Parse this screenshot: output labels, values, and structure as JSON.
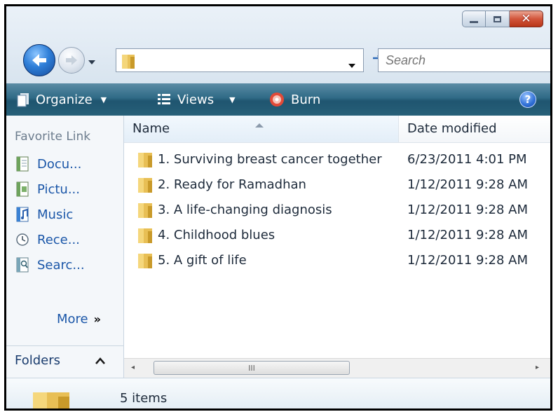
{
  "titlebar": {
    "buttons": [
      "minimize-icon",
      "maximize-icon",
      "close-icon"
    ]
  },
  "nav": {
    "address_value": "",
    "search_placeholder": "Search"
  },
  "command_bar": {
    "organize_label": "Organize",
    "views_label": "Views",
    "burn_label": "Burn",
    "help_label": "?"
  },
  "navigation_pane": {
    "title": "Favorite Link",
    "items": [
      {
        "label": "Docu...",
        "icon": "documents-icon"
      },
      {
        "label": "Pictu...",
        "icon": "pictures-icon"
      },
      {
        "label": "Music",
        "icon": "music-icon"
      },
      {
        "label": "Rece...",
        "icon": "recent-icon"
      },
      {
        "label": "Searc...",
        "icon": "searches-icon"
      }
    ],
    "more_label": "More",
    "more_chevron": "»",
    "folders_label": "Folders"
  },
  "file_list": {
    "columns": {
      "name": "Name",
      "date": "Date modified"
    },
    "rows": [
      {
        "name": "1. Surviving breast cancer together",
        "date": "6/23/2011 4:01 PM"
      },
      {
        "name": "2. Ready for Ramadhan",
        "date": "1/12/2011 9:28 AM"
      },
      {
        "name": "3. A life-changing diagnosis",
        "date": "1/12/2011 9:28 AM"
      },
      {
        "name": "4. Childhood blues",
        "date": "1/12/2011 9:28 AM"
      },
      {
        "name": "5. A gift of life",
        "date": "1/12/2011 9:28 AM"
      }
    ]
  },
  "scrollbar": {
    "left_arrow": "◂",
    "right_arrow": "▸",
    "grip": "III"
  },
  "details": {
    "item_count": "5 items"
  }
}
